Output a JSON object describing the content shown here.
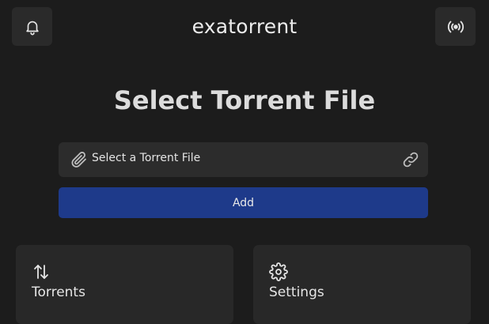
{
  "header": {
    "app_title": "exatorrent",
    "left_icon": "bell-icon",
    "right_icon": "broadcast-icon"
  },
  "main": {
    "page_title": "Select Torrent File",
    "file_input": {
      "placeholder": "Select a Torrent File",
      "left_icon": "paperclip-icon",
      "right_icon": "link-icon"
    },
    "add_button_label": "Add"
  },
  "cards": [
    {
      "label": "Torrents",
      "icon": "arrows-up-down-icon"
    },
    {
      "label": "Settings",
      "icon": "gear-icon"
    }
  ],
  "colors": {
    "background": "#1c1c1c",
    "surface": "#2a2a2a",
    "accent": "#1e3a8a",
    "text": "#e6e6e6"
  }
}
